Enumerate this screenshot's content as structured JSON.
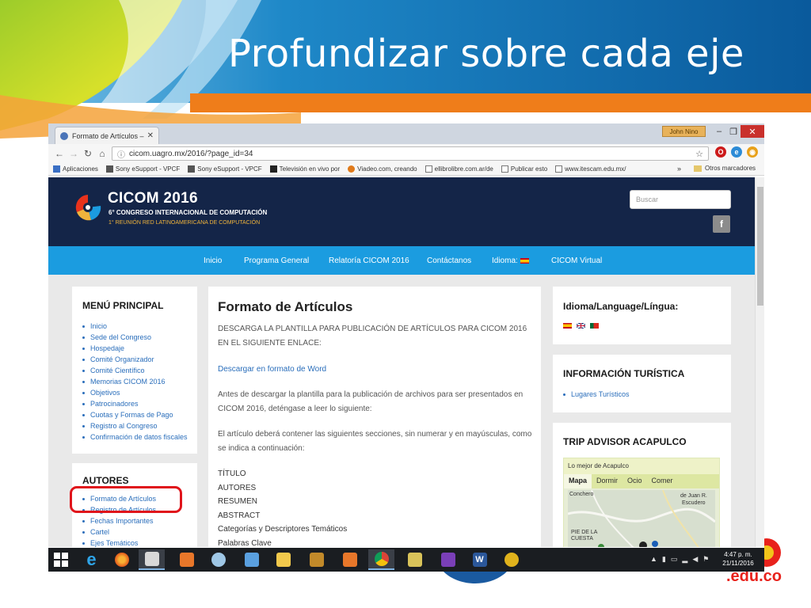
{
  "slide": {
    "title": "Profundizar sobre cada eje"
  },
  "browser": {
    "tab_title": "Formato de Artículos – C",
    "user_chip": "John Nino",
    "url": "cicom.uagro.mx/2016/?page_id=34",
    "bookmarks": [
      "Aplicaciones",
      "Sony eSupport - VPCF",
      "Sony eSupport - VPCF",
      "Televisión en vivo por",
      "Viadeo.com, creando",
      "ellibrolibre.com.ar/de",
      "Publicar esto",
      "www.itescam.edu.mx/"
    ],
    "bookmarks_more": "»",
    "other_bookmarks": "Otros marcadores"
  },
  "site": {
    "logo_title": "CICOM 2016",
    "logo_sub1": "6° CONGRESO INTERNACIONAL DE COMPUTACIÓN",
    "logo_sub2": "1° REUNIÓN RED LATINOAMERICANA DE COMPUTACIÓN",
    "search_placeholder": "Buscar",
    "facebook_label": "f",
    "nav": [
      "Inicio",
      "Programa General",
      "Relatoría CICOM 2016",
      "Contáctanos",
      "Idioma:",
      "CICOM Virtual"
    ]
  },
  "sidebar": {
    "menu_title": "MENÚ PRINCIPAL",
    "menu_items": [
      "Inicio",
      "Sede del Congreso",
      "Hospedaje",
      "Comité Organizador",
      "Comité Científico",
      "Memorias CICOM 2016",
      "Objetivos",
      "Patrocinadores",
      "Cuotas y Formas de Pago",
      "Registro al Congreso",
      "Confirmación de datos fiscales"
    ],
    "authors_title": "AUTORES",
    "author_items": [
      "Formato de Artículos",
      "Registro de Artículos",
      "Fechas Importantes",
      "Cartel",
      "Ejes Temáticos"
    ]
  },
  "content": {
    "title": "Formato de Artículos",
    "download_text": "DESCARGA LA PLANTILLA PARA PUBLICACIÓN DE ARTÍCULOS PARA CICOM 2016 EN EL SIGUIENTE ENLACE:",
    "download_link": "Descargar en formato de Word",
    "para1": "Antes de descargar la plantilla para la publicación de archivos para ser presentados en CICOM 2016, deténgase a leer lo siguiente:",
    "para2": "El artículo deberá contener las siguientes secciones, sin numerar y en mayúsculas, como se indica a continuación:",
    "sections": [
      "TÍTULO",
      "AUTORES",
      "RESUMEN",
      "ABSTRACT",
      "Categorías y Descriptores Temáticos",
      "Palabras Clave"
    ]
  },
  "right": {
    "lang_title": "Idioma/Language/Língua:",
    "tourism_title": "INFORMACIÓN TURÍSTICA",
    "tourism_items": [
      "Lugares Turísticos"
    ],
    "trip_title": "TRIP ADVISOR ACAPULCO",
    "map_header": "Lo mejor de Acapulco",
    "map_tabs": [
      "Mapa",
      "Dormir",
      "Ocio",
      "Comer"
    ],
    "map_labels": [
      "Conchero",
      "de Juan R.",
      "Escudero",
      "PIE DE LA",
      "CUESTA"
    ]
  },
  "taskbar": {
    "time": "4:47 p. m.",
    "date": "21/11/2016"
  }
}
